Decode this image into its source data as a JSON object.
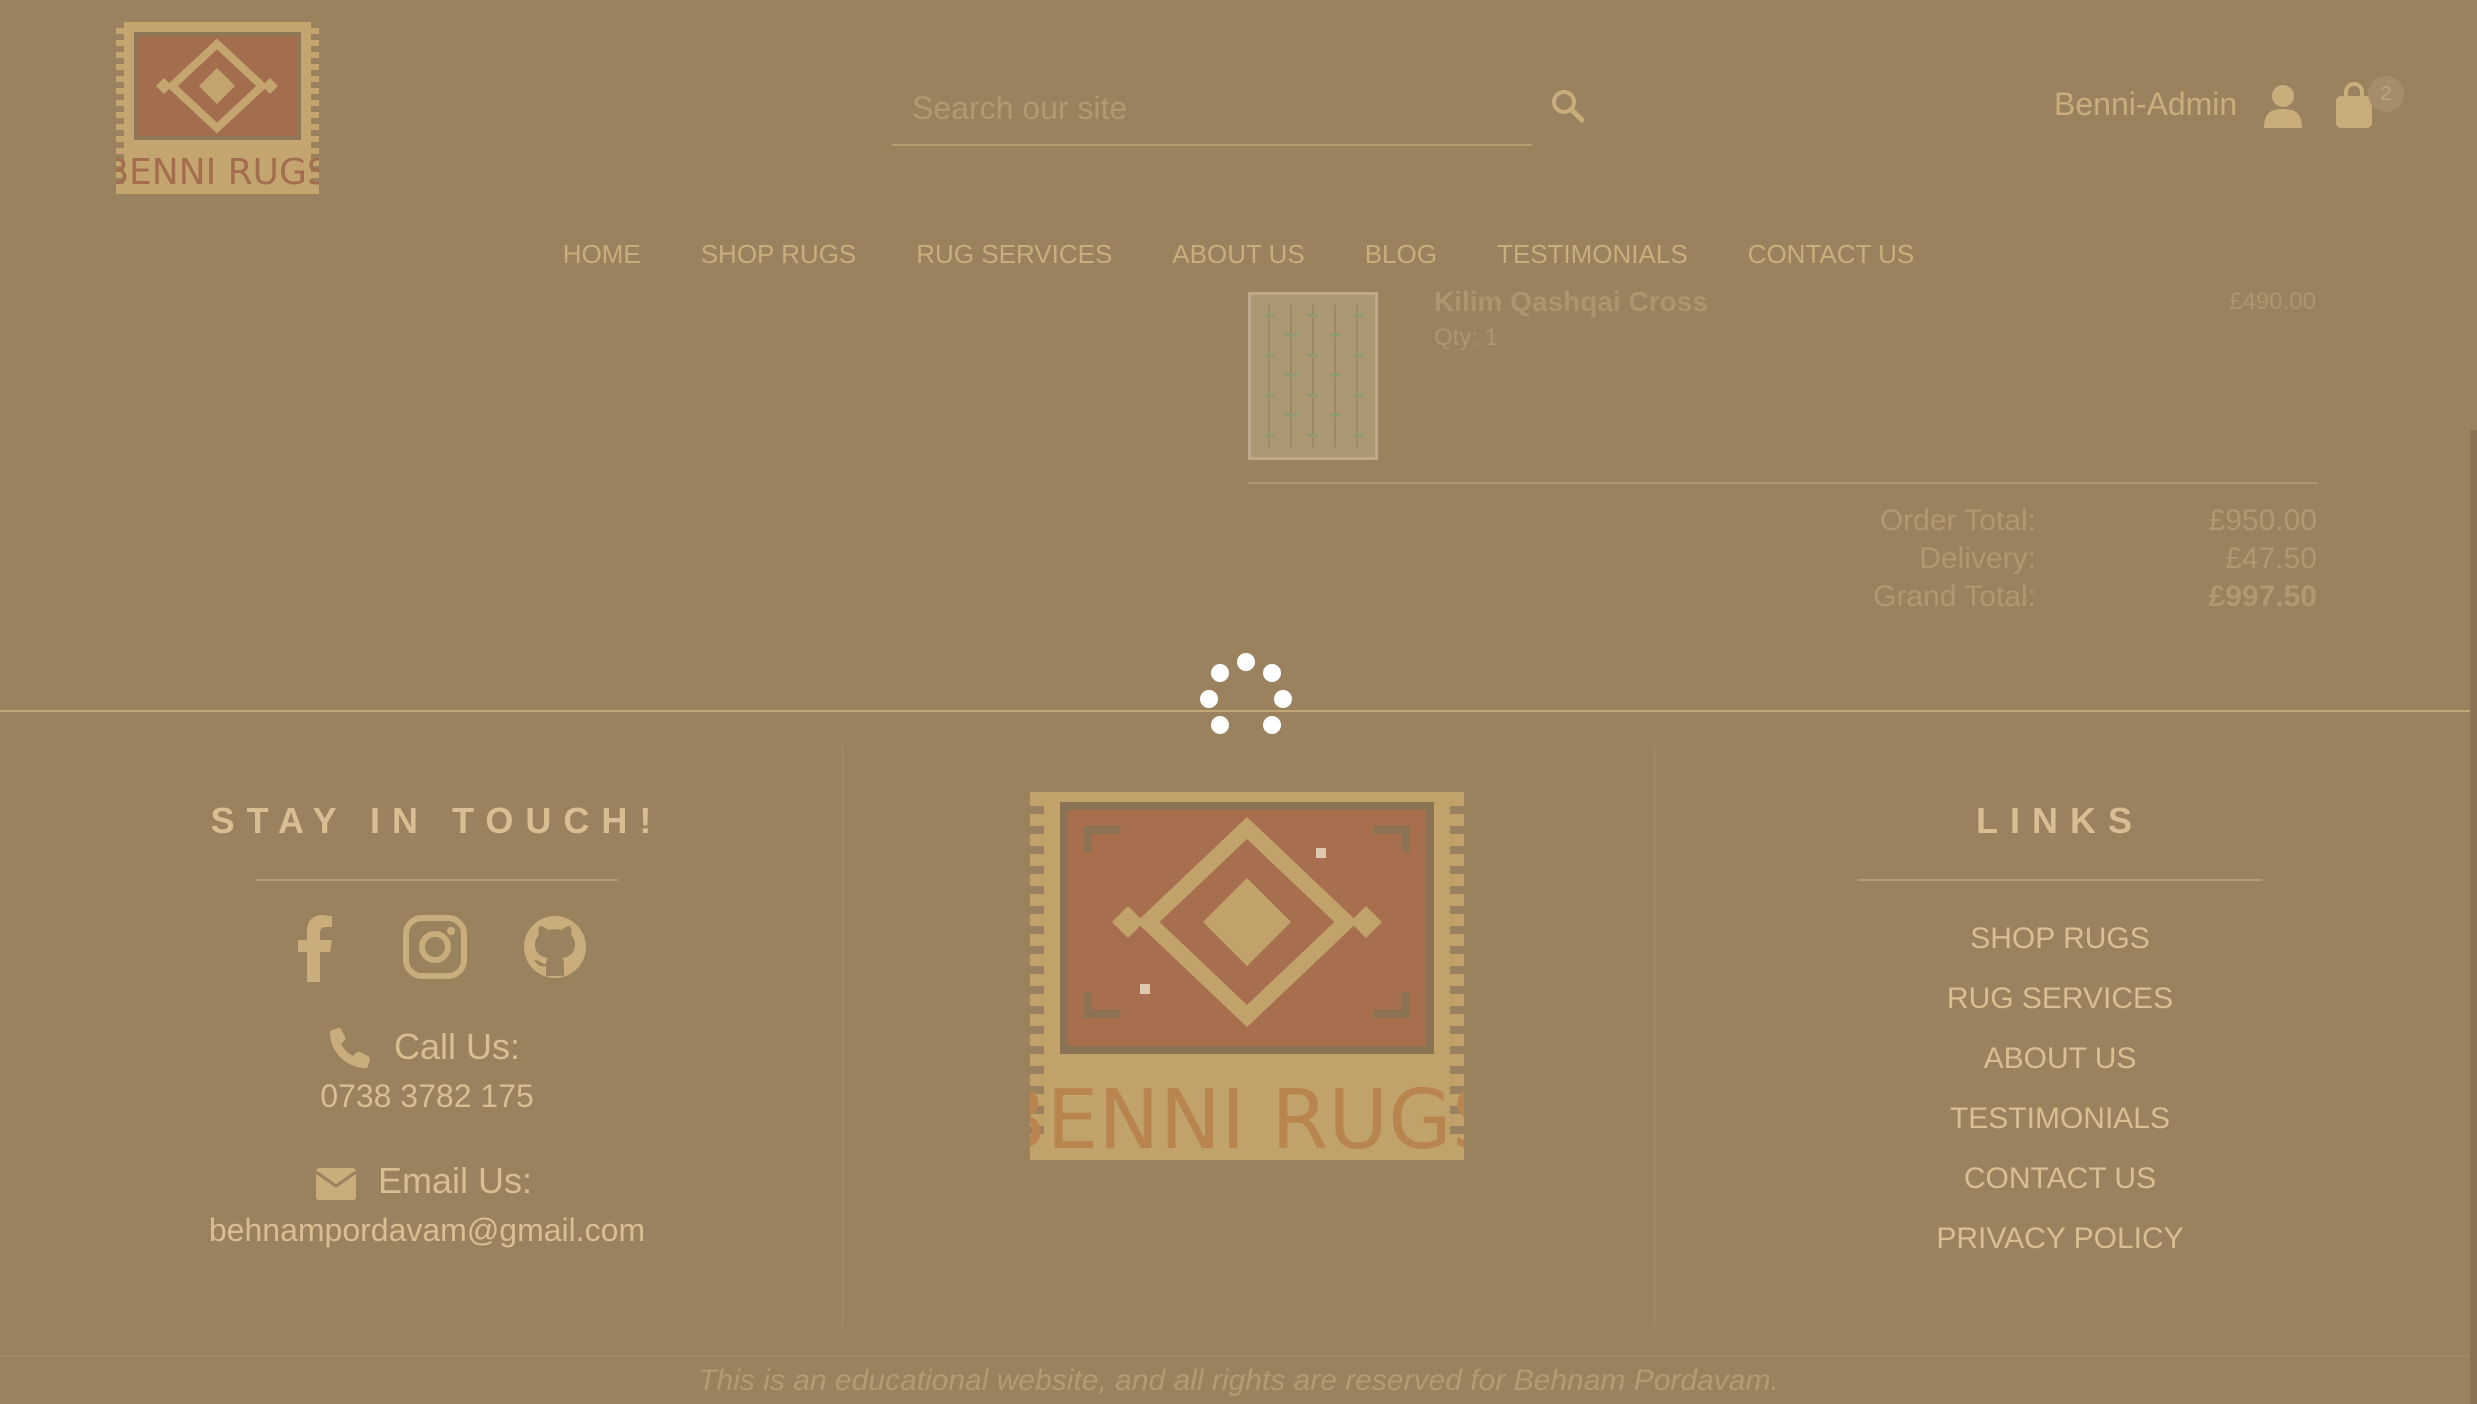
{
  "header": {
    "logo_text": "BENNI RUGS",
    "search": {
      "placeholder": "Search our site"
    },
    "user": {
      "name": "Benni-Admin"
    },
    "cart": {
      "count": "2"
    }
  },
  "nav": {
    "items": [
      "HOME",
      "SHOP RUGS",
      "RUG SERVICES",
      "ABOUT US",
      "BLOG",
      "TESTIMONIALS",
      "CONTACT US"
    ]
  },
  "order": {
    "item": {
      "name": "Kilim Qashqai Cross",
      "qty": "Qty: 1",
      "price": "£490.00"
    },
    "summary": {
      "order_total_label": "Order Total:",
      "order_total": "£950.00",
      "delivery_label": "Delivery:",
      "delivery": "£47.50",
      "grand_total_label": "Grand Total:",
      "grand_total": "£997.50"
    }
  },
  "footer": {
    "stay_heading": "STAY IN TOUCH!",
    "call_label": "Call Us:",
    "phone": "0738 3782 175",
    "email_label": "Email Us:",
    "email": "behnampordavam@gmail.com",
    "logo_text": "BENNI RUGS",
    "links_heading": "LINKS",
    "links": [
      "SHOP RUGS",
      "RUG SERVICES",
      "ABOUT US",
      "TESTIMONIALS",
      "CONTACT US",
      "PRIVACY POLICY"
    ],
    "copyright": "This is an educational website, and all rights are reserved for Behnam Pordavam."
  },
  "colors": {
    "overlay_bg": "#9b825e",
    "text_gold": "#d7be93",
    "rug_red": "#a86f4f"
  },
  "icons": [
    "search-icon",
    "user-icon",
    "shopping-bag-icon",
    "facebook-icon",
    "instagram-icon",
    "github-icon",
    "phone-icon",
    "envelope-icon",
    "loading-spinner-icon"
  ]
}
